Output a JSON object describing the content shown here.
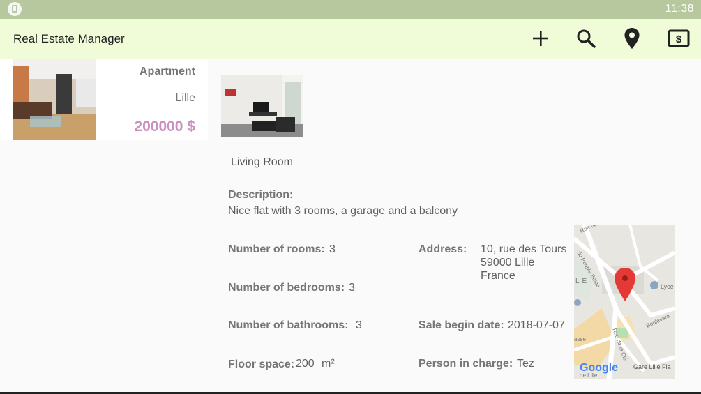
{
  "status_bar": {
    "time": "11:38",
    "app_icon": "phone-icon"
  },
  "app_bar": {
    "title": "Real Estate Manager",
    "actions": [
      {
        "name": "add",
        "icon": "plus-icon"
      },
      {
        "name": "search",
        "icon": "search-icon"
      },
      {
        "name": "map",
        "icon": "location-pin-icon"
      },
      {
        "name": "currency",
        "icon": "dollar-icon"
      }
    ]
  },
  "list": {
    "items": [
      {
        "type": "Apartment",
        "city": "Lille",
        "price": "200000 $"
      }
    ]
  },
  "detail": {
    "photo_caption": "Living Room",
    "description_label": "Description:",
    "description": "Nice flat with 3 rooms, a garage and a balcony",
    "rooms_label": "Number of rooms:",
    "rooms": "3",
    "bedrooms_label": "Number of bedrooms:",
    "bedrooms": "3",
    "bathrooms_label": "Number of bathrooms:",
    "bathrooms": "3",
    "floor_label": "Floor space:",
    "floor_value": "200",
    "floor_unit": "m²",
    "address_label": "Address:",
    "address_line1": "10, rue des Tours",
    "address_line2": "59000 Lille",
    "address_line3": "France",
    "sale_label": "Sale begin date:",
    "sale_date": "2018-07-07",
    "person_label": "Person in charge:",
    "person": "Tez"
  },
  "map": {
    "labels": [
      "Rue de Thionville",
      "du Peuple Belge",
      "LE",
      "Lycé",
      "Boulevard",
      "Rue de la Clé",
      "asse",
      "Google",
      "Gare Lille Fla",
      "de Lille"
    ],
    "marker_color": "#e53935"
  },
  "colors": {
    "status_bar": "#b7c89e",
    "app_bar": "#f0fbd8",
    "price": "#c98fbe"
  }
}
